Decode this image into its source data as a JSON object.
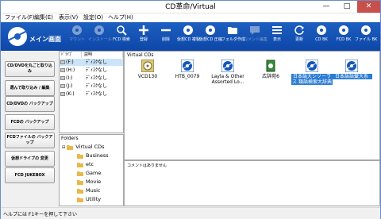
{
  "window": {
    "title": "CD革命/Virtual",
    "controls": {
      "minimize": "—",
      "maximize": "□",
      "close": "✕"
    }
  },
  "menu": [
    "ファイル(F)",
    "編集(E)",
    "表示(V)",
    "設定(O)",
    "ヘルプ(H)"
  ],
  "toolbar": {
    "logo_label": "メイン画面",
    "buttons": [
      {
        "label": "マウント",
        "icon": "mount-icon",
        "enabled": false
      },
      {
        "label": "インストール",
        "icon": "install-icon",
        "enabled": false
      },
      {
        "label": "FCD 検索",
        "icon": "search-icon",
        "enabled": true
      },
      {
        "label": "登録",
        "icon": "add-icon",
        "enabled": true
      },
      {
        "label": "削除",
        "icon": "remove-icon",
        "enabled": true
      },
      {
        "label": "仮想CD 複製",
        "icon": "copy-icon",
        "enabled": true
      },
      {
        "label": "仮想CD 圧縮",
        "icon": "compress-icon",
        "enabled": true
      },
      {
        "label": "フォルダ作成",
        "icon": "folder-icon",
        "enabled": true
      },
      {
        "label": "コメント編集",
        "icon": "comment-icon",
        "enabled": false
      },
      {
        "label": "表示",
        "icon": "view-icon",
        "enabled": true
      },
      {
        "label": "更新",
        "icon": "refresh-icon",
        "enabled": true
      },
      {
        "label": "CD BK",
        "icon": "cd-backup-icon",
        "enabled": true
      },
      {
        "label": "FCD BK",
        "icon": "fcd-backup-icon",
        "enabled": true
      },
      {
        "label": "ファイル BK",
        "icon": "file-backup-icon",
        "enabled": true
      }
    ]
  },
  "left_buttons": [
    "CD/DVDを丸ごと取り込み",
    "選んで取り込み / 編集",
    "CD/DVDの バックアップ",
    "FCDの バックアップ",
    "FCDファイルの バックアップ",
    "仮想ドライブの 変更",
    "FCD JUKEBOX"
  ],
  "drives": {
    "headers": {
      "drive": "ﾄﾞﾗｲﾌﾞ",
      "desc": "説明"
    },
    "rows": [
      {
        "letter": "(F:)",
        "desc": "ﾃﾞｨｽｸなし"
      },
      {
        "letter": "(H:)",
        "desc": "ﾃﾞｨｽｸなし"
      },
      {
        "letter": "(I:)",
        "desc": "ﾃﾞｨｽｸなし"
      },
      {
        "letter": "(J:)",
        "desc": "ﾃﾞｨｽｸなし"
      },
      {
        "letter": "(K:)",
        "desc": "ﾃﾞｨｽｸなし"
      }
    ]
  },
  "folders": {
    "header": "Folders",
    "root": "Virtual CDs",
    "children": [
      "Business",
      "etc",
      "Game",
      "Movie",
      "Music",
      "Utility"
    ]
  },
  "cds": {
    "header": "Virtual CDs",
    "items": [
      {
        "label": "VCD130",
        "selected": false
      },
      {
        "label": "HTB_0079",
        "selected": false
      },
      {
        "label": "Layla & Other Assorted Lo...",
        "selected": false
      },
      {
        "label": "広辞苑6",
        "selected": false
      },
      {
        "label": "日本語大シソーラス 類語検索大辞典",
        "selected": true
      },
      {
        "label": "日本語語彙大系",
        "selected": true
      }
    ]
  },
  "comment": {
    "text": "コメントはありません"
  },
  "status": {
    "text": "ヘルプには F1キーを押して下さい"
  },
  "colors": {
    "toolbar": "#1557b8",
    "selection": "#2b7cd3",
    "folder": "#e8b84a"
  }
}
